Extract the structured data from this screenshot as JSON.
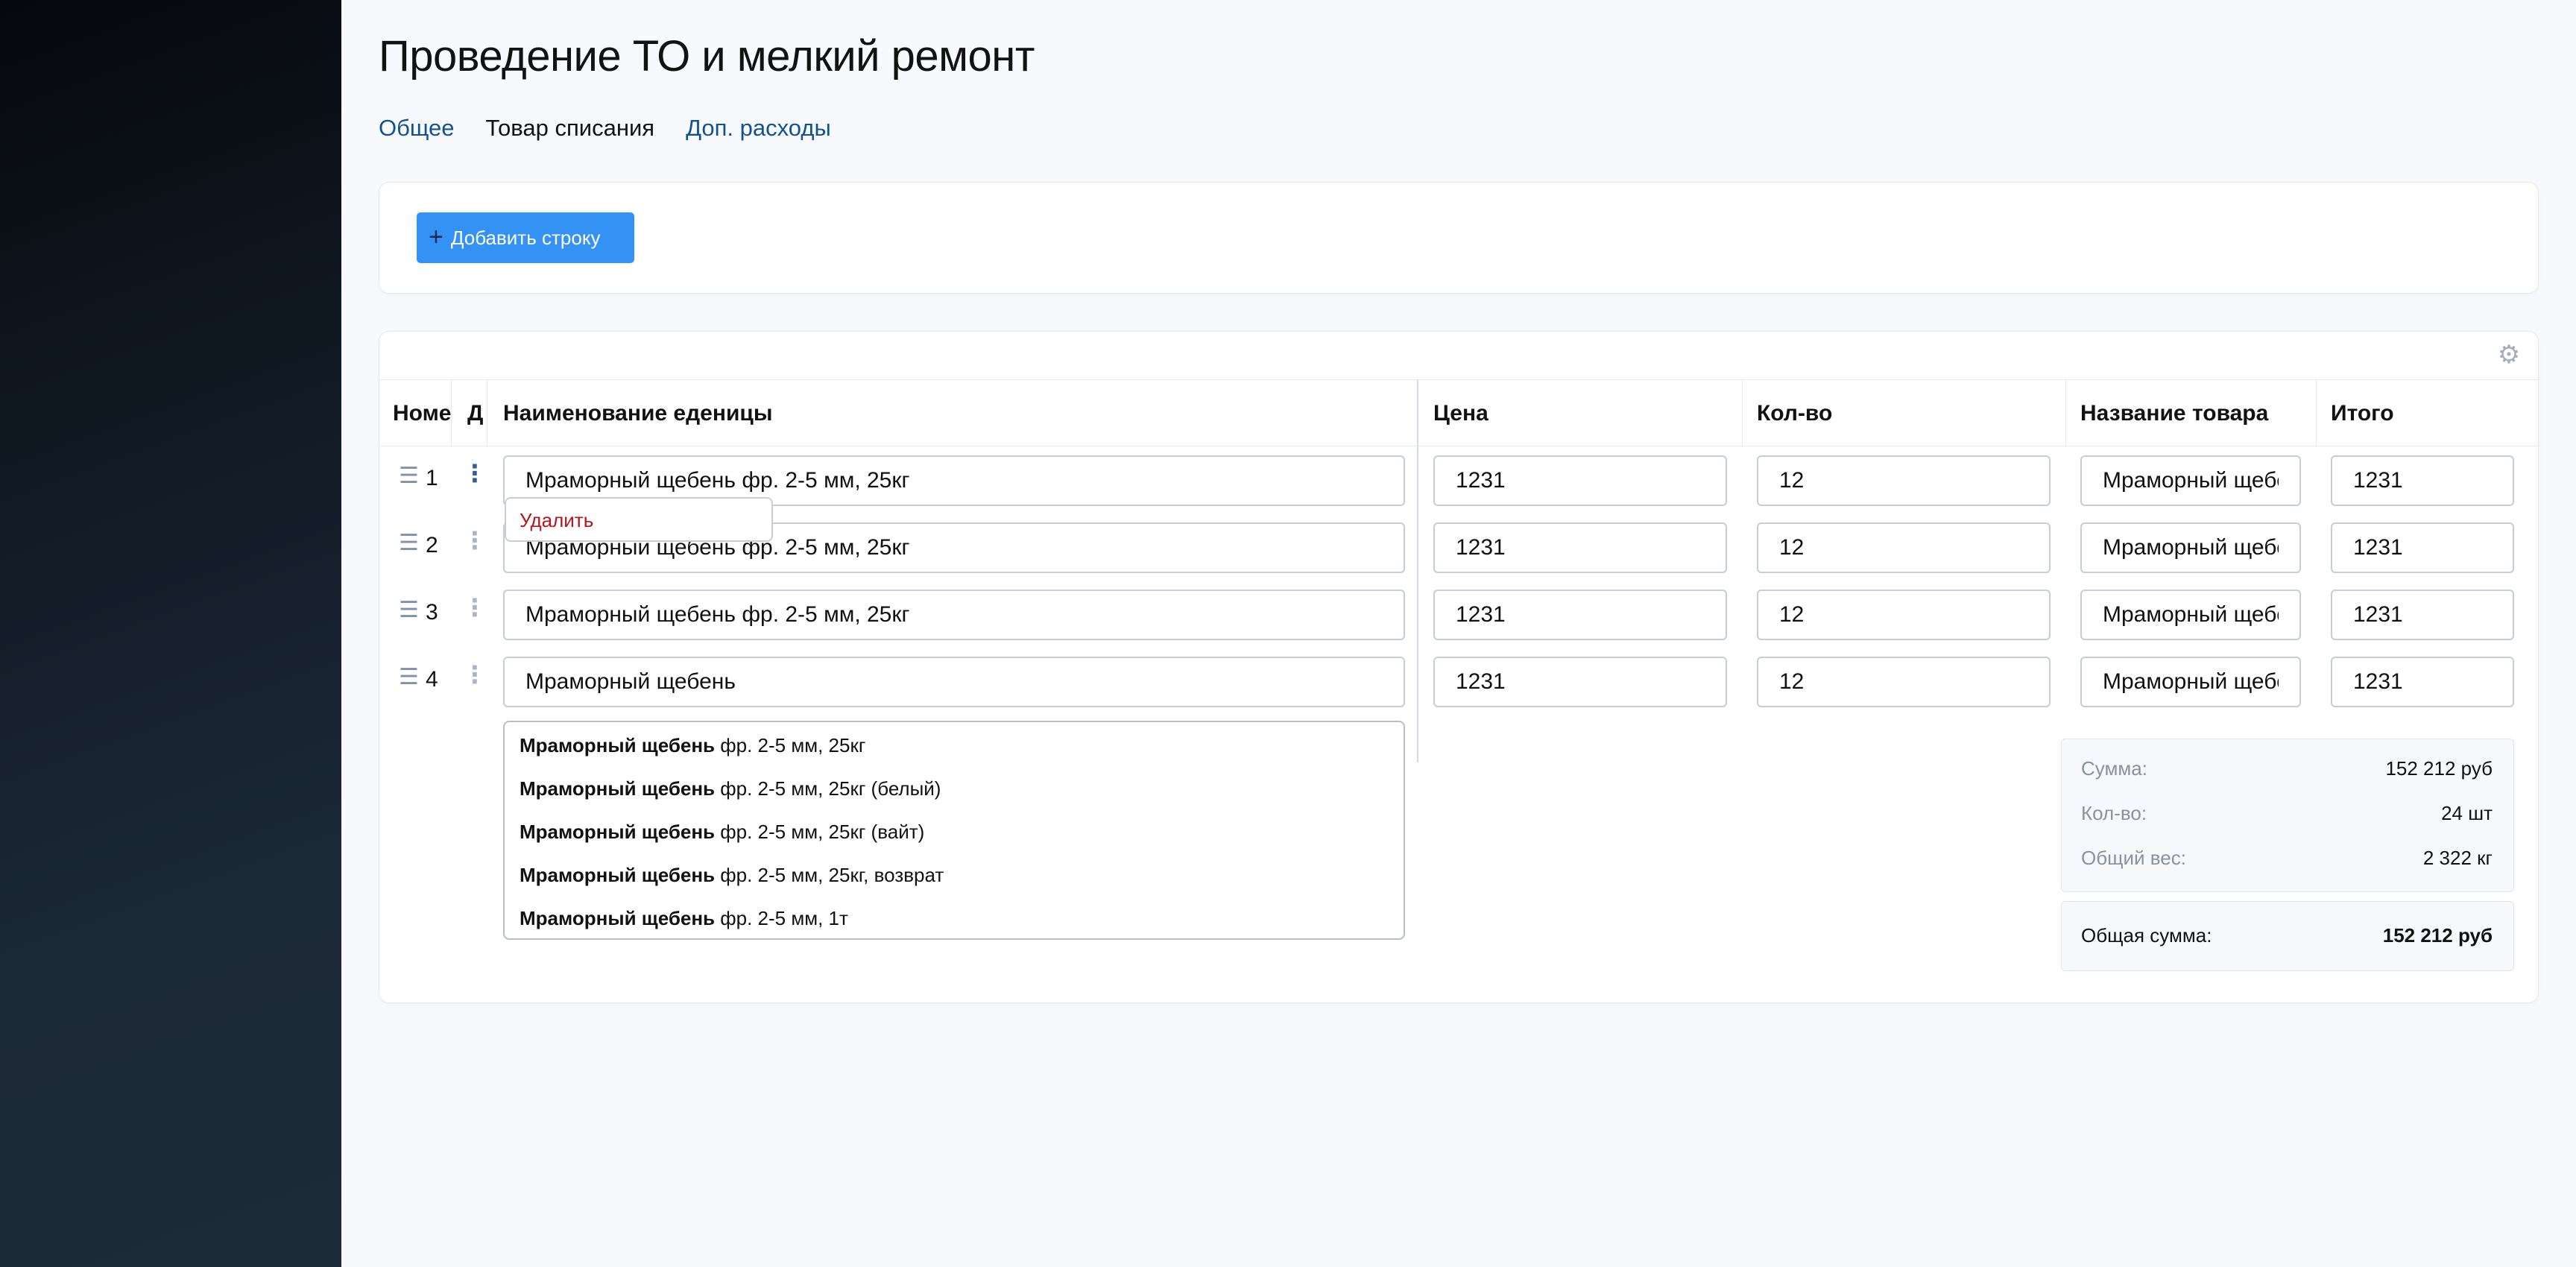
{
  "page": {
    "title": "Проведение ТО и мелкий ремонт"
  },
  "tabs": [
    {
      "label": "Общее",
      "active": false
    },
    {
      "label": "Товар списания",
      "active": true
    },
    {
      "label": "Доп. расходы",
      "active": false
    }
  ],
  "toolbar": {
    "add_row_label": "Добавить строку",
    "add_icon": "plus-icon"
  },
  "table": {
    "settings_icon": "gear-icon",
    "columns": [
      "Номе",
      "Д",
      "Наименование еденицы",
      "Цена",
      "Кол-во",
      "Название товара",
      "Итого"
    ],
    "rows": [
      {
        "num": "1",
        "name": "Мраморный щебень фр. 2-5 мм, 25кг",
        "price": "1231",
        "qty": "12",
        "product": "Мраморный щебень",
        "total": "1231"
      },
      {
        "num": "2",
        "name": "Мраморный щебень фр. 2-5 мм, 25кг",
        "price": "1231",
        "qty": "12",
        "product": "Мраморный щебень",
        "total": "1231"
      },
      {
        "num": "3",
        "name": "Мраморный щебень фр. 2-5 мм, 25кг",
        "price": "1231",
        "qty": "12",
        "product": "Мраморный щебень",
        "total": "1231"
      },
      {
        "num": "4",
        "name": "Мраморный щебень",
        "price": "1231",
        "qty": "12",
        "product": "Мраморный щебень",
        "total": "1231"
      }
    ],
    "row_menu": {
      "delete_label": "Удалить"
    }
  },
  "suggestions": {
    "query": "Мраморный щебень",
    "items": [
      {
        "match": "Мраморный щебень",
        "rest": " фр. 2-5 мм, 25кг"
      },
      {
        "match": "Мраморный щебень",
        "rest": " фр. 2-5 мм, 25кг (белый)"
      },
      {
        "match": "Мраморный щебень",
        "rest": " фр. 2-5 мм, 25кг (вайт)"
      },
      {
        "match": "Мраморный щебень",
        "rest": " фр. 2-5 мм, 25кг, возврат"
      },
      {
        "match": "Мраморный щебень",
        "rest": " фр. 2-5 мм, 1т"
      }
    ]
  },
  "summary": {
    "sum_label": "Сумма:",
    "sum_value": "152 212 руб",
    "qty_label": "Кол-во:",
    "qty_value": "24 шт",
    "weight_label": "Общий вес:",
    "weight_value": "2 322 кг",
    "total_label": "Общая сумма:",
    "total_value": "152 212 руб"
  },
  "colors": {
    "accent": "#3592f5",
    "link": "#14528f",
    "danger": "#b4161b"
  }
}
